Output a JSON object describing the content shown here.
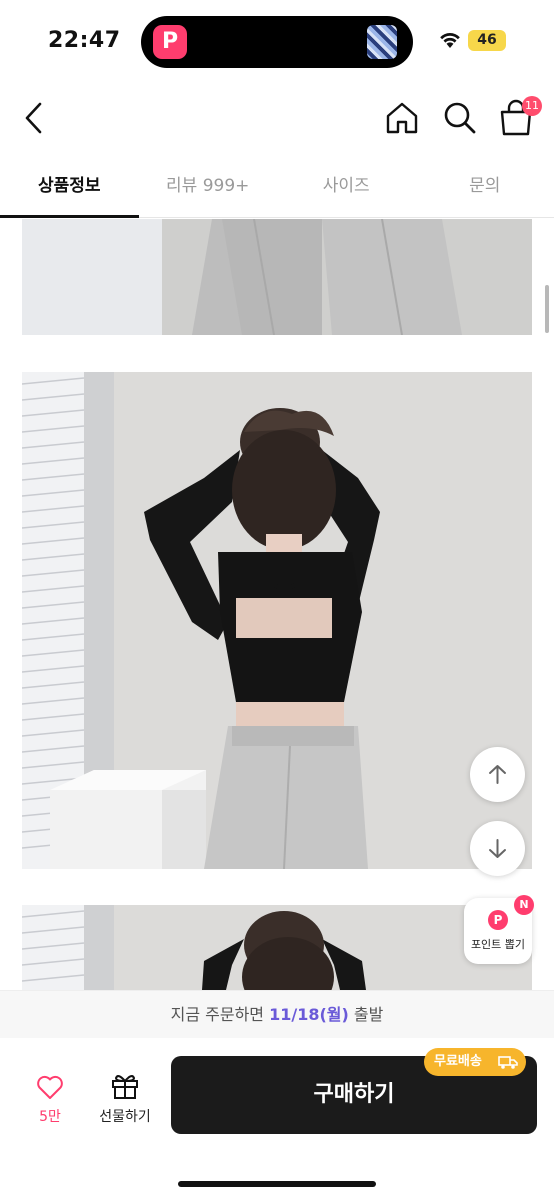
{
  "status_bar": {
    "time": "22:47",
    "app_icon_letter": "P",
    "battery": "46"
  },
  "header": {
    "back_icon": "chevron-left-icon",
    "home_icon": "home-icon",
    "search_icon": "search-icon",
    "cart_icon": "shopping-bag-icon",
    "cart_count": "11"
  },
  "tabs": [
    {
      "label": "상품정보",
      "active": true
    },
    {
      "label": "리뷰 999+",
      "active": false
    },
    {
      "label": "사이즈",
      "active": false
    },
    {
      "label": "문의",
      "active": false
    }
  ],
  "floating": {
    "scroll_up_icon": "arrow-up-icon",
    "scroll_down_icon": "arrow-down-icon",
    "point_badge": "P",
    "point_new": "N",
    "point_label": "포인트 뽑기"
  },
  "shipping": {
    "prefix": "지금 주문하면 ",
    "date": "11/18(월)",
    "suffix": " 출발"
  },
  "bottom": {
    "like_count": "5만",
    "gift_label": "선물하기",
    "buy_label": "구매하기",
    "free_shipping": "무료배송"
  },
  "colors": {
    "accent": "#ff3d6e",
    "ship_date": "#6a5ad8",
    "buy_button": "#1b1b1b",
    "free_shipping": "#f7b52c"
  }
}
